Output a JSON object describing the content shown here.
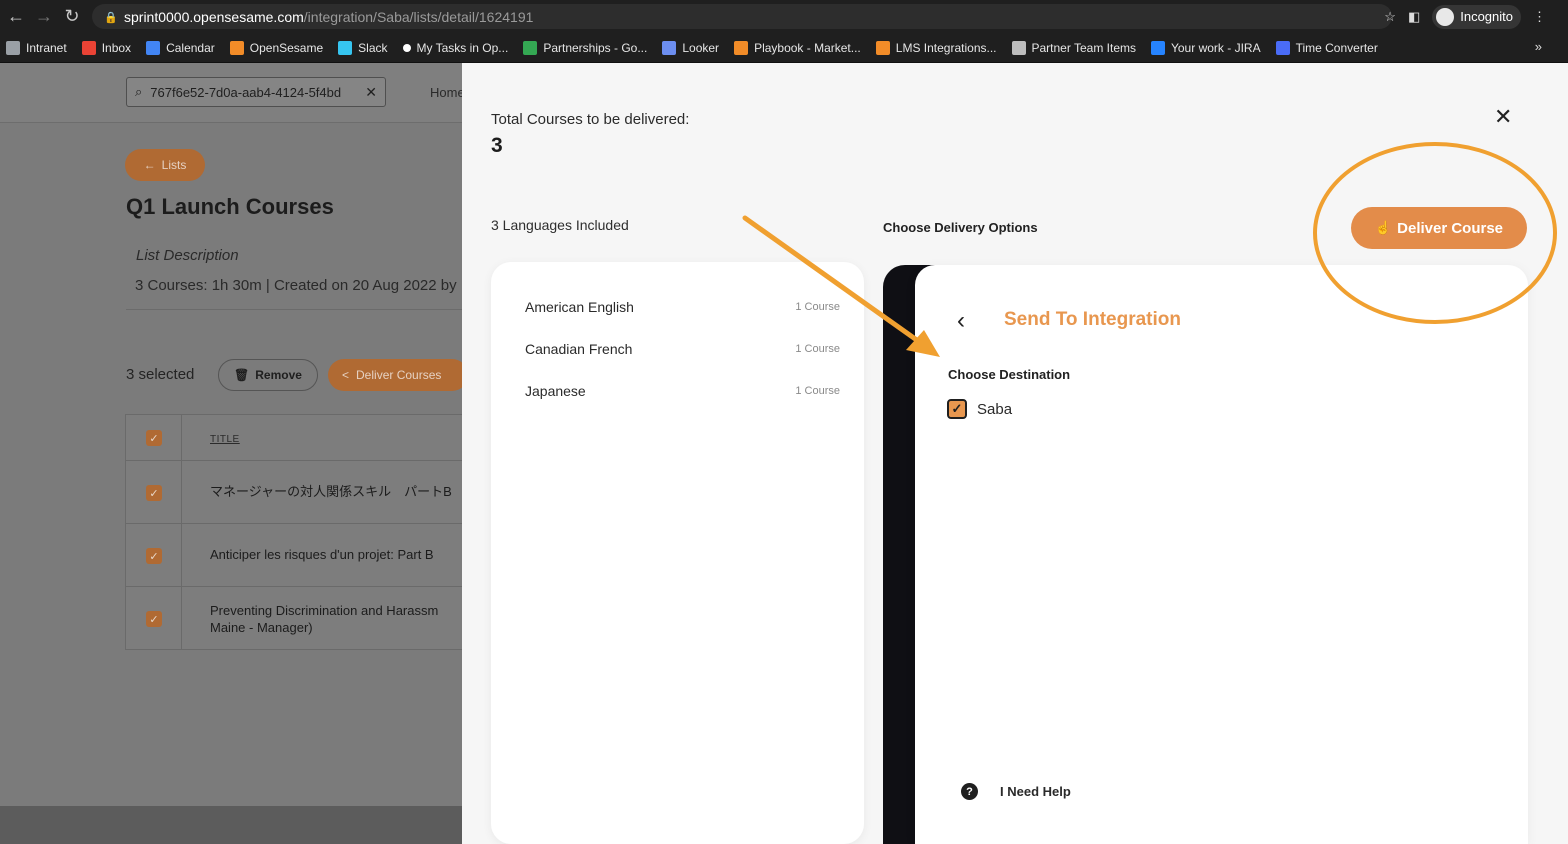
{
  "browser": {
    "url_host": "sprint0000.opensesame.com",
    "url_path": "/integration/Saba/lists/detail/1624191",
    "profile_label": "Incognito",
    "bookmarks": [
      {
        "label": "Intranet",
        "color": "#9aa0a6"
      },
      {
        "label": "Inbox",
        "color": "#ea4335"
      },
      {
        "label": "Calendar",
        "color": "#4285f4"
      },
      {
        "label": "OpenSesame",
        "color": "#f28c28"
      },
      {
        "label": "Slack",
        "color": "#36c5f0"
      },
      {
        "label": "My Tasks in Op...",
        "color": "#ffffff"
      },
      {
        "label": "Partnerships - Go...",
        "color": "#34a853"
      },
      {
        "label": "Looker",
        "color": "#6c8ef0"
      },
      {
        "label": "Playbook - Market...",
        "color": "#f28c28"
      },
      {
        "label": "LMS Integrations...",
        "color": "#f28c28"
      },
      {
        "label": "Partner Team Items",
        "color": "#bdbdbd"
      },
      {
        "label": "Your work - JIRA",
        "color": "#2684ff"
      },
      {
        "label": "Time Converter",
        "color": "#4a6cf7"
      }
    ],
    "bookmarks_more": "»"
  },
  "page": {
    "search_value": "767f6e52-7d0a-aab4-4124-5f4bd",
    "home_link": "Home",
    "lists_button": "Lists",
    "title": "Q1 Launch Courses",
    "description_label": "List Description",
    "meta": "3 Courses: 1h 30m | Created on 20 Aug 2022 by",
    "selected": "3 selected",
    "remove_button": "Remove",
    "deliver_courses_button": "Deliver Courses",
    "table": {
      "column_title": "TITLE",
      "rows": [
        {
          "title": "マネージャーの対人関係スキル　パートB"
        },
        {
          "title": "Anticiper les risques d'un projet: Part B"
        },
        {
          "title": "Preventing Discrimination and Harassm",
          "title_line2": "Maine - Manager)"
        }
      ]
    }
  },
  "drawer": {
    "total_label": "Total Courses to be delivered:",
    "total_value": "3",
    "languages_label": "3 Languages Included",
    "languages": [
      {
        "name": "American English",
        "count": "1 Course"
      },
      {
        "name": "Canadian French",
        "count": "1 Course"
      },
      {
        "name": "Japanese",
        "count": "1 Course"
      }
    ],
    "delivery_options_label": "Choose Delivery Options",
    "deliver_course_button": "Deliver Course",
    "integration": {
      "title": "Send To Integration",
      "destination_label": "Choose Destination",
      "destinations": [
        {
          "name": "Saba",
          "checked": true
        }
      ],
      "help": "I Need Help"
    }
  },
  "colors": {
    "accent": "#e38c4a",
    "annotation": "#f0a030"
  }
}
